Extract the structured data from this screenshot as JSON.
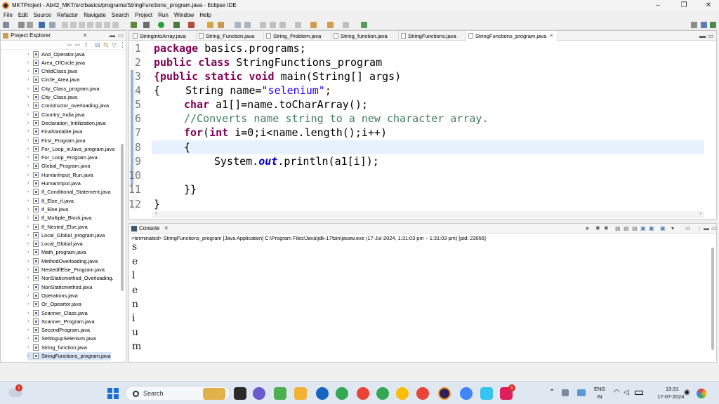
{
  "window": {
    "title": "MKTProject - Ab42_MKT/src/basics/programs/StringFunctions_program.java - Eclipse IDE",
    "min": "–",
    "max": "❐",
    "close": "✕"
  },
  "menu": [
    "File",
    "Edit",
    "Source",
    "Refactor",
    "Navigate",
    "Search",
    "Project",
    "Run",
    "Window",
    "Help"
  ],
  "explorer": {
    "title": "Project Explorer",
    "items": [
      "And_Operator.java",
      "Area_OfCircle.java",
      "ChildClass.java",
      "Circle_Area.java",
      "City_Class_program.java",
      "City_Class.java",
      "Constructor_overloading.java",
      "Country_India.java",
      "Declaration_Initilization.java",
      "FinalVariable.java",
      "First_Program.java",
      "For_Loop_inJava_program.java",
      "For_Loop_Program.java",
      "Global_Program.java",
      "HumanInput_Run.java",
      "HumanInput.java",
      "If_Conditional_Statement.java",
      "If_Else_if.java",
      "If_Else.java",
      "If_Multiple_Block.java",
      "If_Nested_Else.java",
      "Local_Global_program.java",
      "Local_Global.java",
      "Math_program.java",
      "MethodOverloading.java",
      "NestedIfElse_Program.java",
      "NonStaticmethod_Overloading.",
      "NonStaticmethod.java",
      "Operations.java",
      "Or_Opeartor.java",
      "Scanner_Class.java",
      "Scanner_Program.java",
      "SecondProgram.java",
      "SettingupSelenium.java",
      "String_function.java",
      "StringFunctions_program.java",
      "StringFunctions.java"
    ],
    "selected_index": 35
  },
  "tabs": [
    {
      "label": "StringintoArray.java",
      "active": false
    },
    {
      "label": "String_Function.java",
      "active": false
    },
    {
      "label": "String_Problem.java",
      "active": false
    },
    {
      "label": "String_function.java",
      "active": false
    },
    {
      "label": "StringFunctions.java",
      "active": false
    },
    {
      "label": "StringFunctions_program.java",
      "active": true
    }
  ],
  "code": {
    "line_numbers": [
      "1",
      "2",
      "3",
      "4",
      "5",
      "6",
      "7",
      "8",
      "9",
      "10",
      "11",
      "12"
    ],
    "l1_kw": "package",
    "l1_rest": " basics.programs;",
    "l2_kw": "public class",
    "l2_rest": " StringFunctions_program",
    "l3_kw1": "{public static void",
    "l3_rest": " main(String[] args)",
    "l4_pre": "{    String name=",
    "l4_str": "\"selenium\"",
    "l4_post": ";",
    "l5_kw": "char",
    "l5_rest": " a1[]=name.toCharArray();",
    "l6_cmt": "//Converts name string to a new character array.",
    "l7_kw1": "for",
    "l7_mid": "(",
    "l7_kw2": "int",
    "l7_rest": " i=0;i<name.length();i++)",
    "l8": "{",
    "l9_pre": "System.",
    "l9_fld": "out",
    "l9_post": ".println(a1[i]);",
    "l11": "}}",
    "l12": "}"
  },
  "console": {
    "title": "Console",
    "terminated": "<terminated> StringFunctions_program [Java Application] C:\\Program Files\\Java\\jdk-17\\bin\\javaw.exe  (17-Jul-2024, 1:31:03 pm – 1:31:03 pm) [pid: 23056]",
    "output": [
      "s",
      "e",
      "l",
      "e",
      "n",
      "i",
      "u",
      "m"
    ]
  },
  "taskbar": {
    "search_placeholder": "Search",
    "lang": "ENG",
    "region": "IN",
    "time": "13:31",
    "date": "17-07-2024",
    "weather_badge": "1",
    "chat_badge": "1"
  }
}
